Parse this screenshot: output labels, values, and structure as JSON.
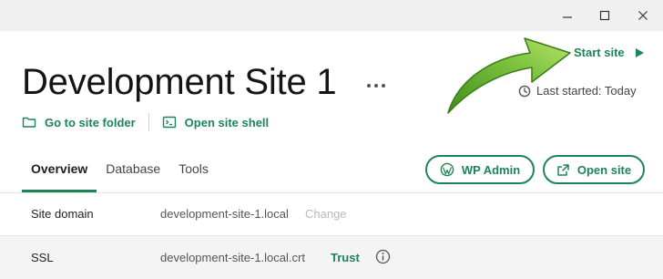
{
  "window_controls": {
    "minimize": "–",
    "maximize": "☐",
    "close": "✕"
  },
  "header": {
    "site_title": "Development Site 1",
    "start_site_label": "Start site",
    "last_started": "Last started: Today"
  },
  "actions": {
    "go_to_folder": "Go to site folder",
    "open_shell": "Open site shell"
  },
  "tabs": [
    {
      "label": "Overview",
      "active": true
    },
    {
      "label": "Database",
      "active": false
    },
    {
      "label": "Tools",
      "active": false
    }
  ],
  "buttons": {
    "wp_admin": "WP Admin",
    "open_site": "Open site"
  },
  "details": {
    "domain_label": "Site domain",
    "domain_value": "development-site-1.local",
    "domain_change": "Change",
    "ssl_label": "SSL",
    "ssl_value": "development-site-1.local.crt",
    "ssl_trust": "Trust"
  },
  "colors": {
    "accent": "#1e8457",
    "arrow": "#7cc23f"
  }
}
